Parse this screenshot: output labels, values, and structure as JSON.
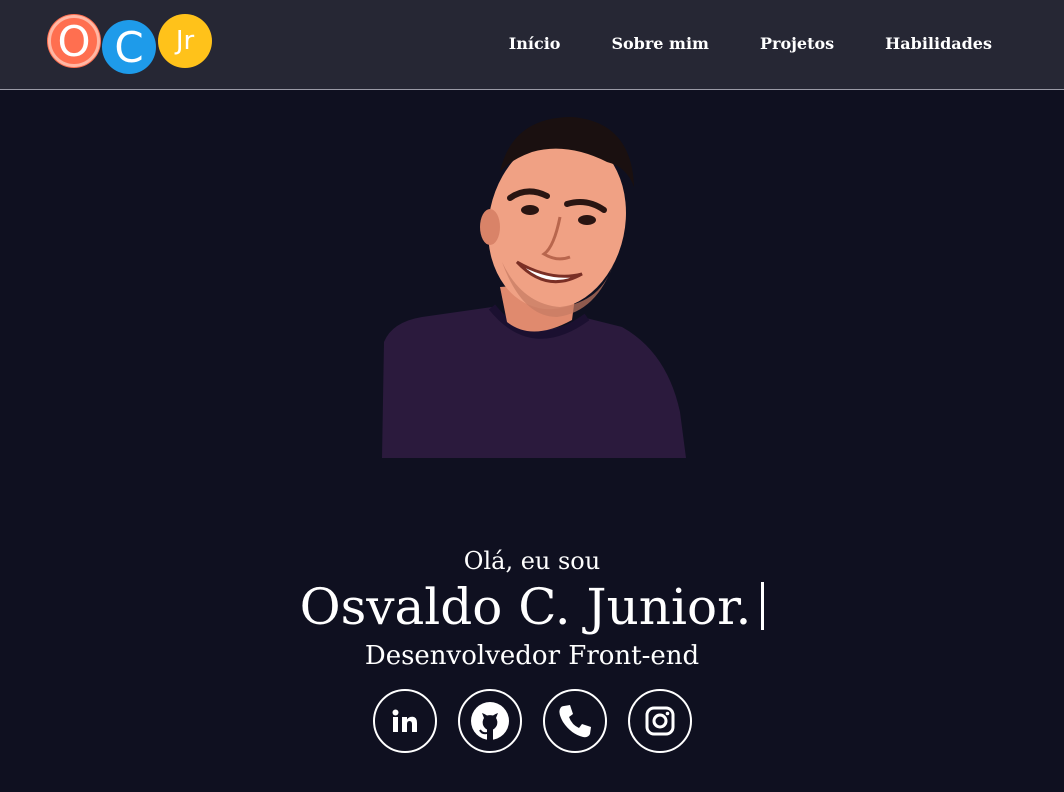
{
  "logo": {
    "letters": [
      "O",
      "C",
      "Jr"
    ],
    "colors": [
      "#ff6f50",
      "#1e9bea",
      "#ffc21a"
    ]
  },
  "nav": {
    "items": [
      {
        "label": "Início"
      },
      {
        "label": "Sobre mim"
      },
      {
        "label": "Projetos"
      },
      {
        "label": "Habilidades"
      }
    ]
  },
  "hero": {
    "greeting": "Olá, eu sou",
    "name": "Osvaldo C. Junior.",
    "role": "Desenvolvedor Front-end"
  },
  "socials": [
    {
      "icon": "linkedin-icon"
    },
    {
      "icon": "github-icon"
    },
    {
      "icon": "phone-icon"
    },
    {
      "icon": "instagram-icon"
    }
  ],
  "colors": {
    "background": "#0f1020",
    "navbar": "#262734",
    "text": "#ffffff",
    "shirt": "#2b1a3d"
  }
}
